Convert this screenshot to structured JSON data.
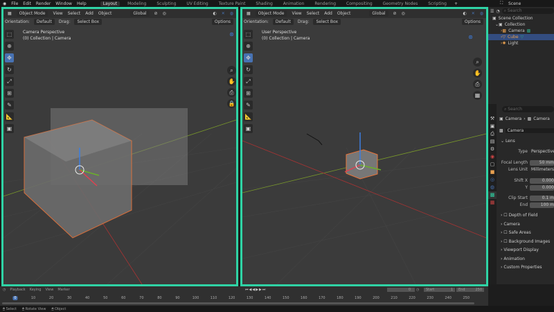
{
  "menu": [
    "File",
    "Edit",
    "Render",
    "Window",
    "Help"
  ],
  "workspaces": [
    "Layout",
    "Modeling",
    "Sculpting",
    "UV Editing",
    "Texture Paint",
    "Shading",
    "Animation",
    "Rendering",
    "Compositing",
    "Geometry Nodes",
    "Scripting"
  ],
  "active_workspace": "Layout",
  "scene": "Scene",
  "viewport_header": {
    "mode": "Object Mode",
    "view": "View",
    "select": "Select",
    "add": "Add",
    "object": "Object",
    "transform": "Global",
    "orientation_label": "Orientation:",
    "orientation": "Default",
    "drag_label": "Drag:",
    "drag": "Select Box",
    "options": "Options"
  },
  "left_viewport": {
    "title": "Camera Perspective",
    "collection": "(0) Collection | Camera"
  },
  "right_viewport": {
    "title": "User Perspective",
    "collection": "(0) Collection | Camera"
  },
  "outliner": {
    "search_placeholder": "Search",
    "items": [
      {
        "label": "Scene Collection"
      },
      {
        "label": "Collection"
      },
      {
        "label": "Camera"
      },
      {
        "label": "Cube"
      },
      {
        "label": "Light"
      }
    ]
  },
  "properties": {
    "search_placeholder": "Search",
    "breadcrumb": [
      "Camera",
      "Camera"
    ],
    "data_name": "Camera",
    "lens_section": "Lens",
    "fields": [
      {
        "label": "Type",
        "value": "Perspective"
      },
      {
        "label": "Focal Length",
        "value": "50 mm"
      },
      {
        "label": "Lens Unit",
        "value": "Millimeters"
      },
      {
        "label": "Shift X",
        "value": "0.000"
      },
      {
        "label": "Y",
        "value": "0.000"
      },
      {
        "label": "Clip Start",
        "value": "0.1 m"
      },
      {
        "label": "End",
        "value": "100 m"
      }
    ],
    "sections": [
      "Depth of Field",
      "Camera",
      "Safe Areas",
      "Background Images",
      "Viewport Display",
      "Animation",
      "Custom Properties"
    ]
  },
  "timeline": {
    "menus": [
      "Playback",
      "Keying",
      "View",
      "Marker"
    ],
    "current_frame": "0",
    "start_label": "Start",
    "start": "1",
    "end_label": "End",
    "end": "250",
    "ticks": [
      "0",
      "10",
      "20",
      "30",
      "40",
      "50",
      "60",
      "70",
      "80",
      "90",
      "100",
      "110",
      "120",
      "130",
      "140",
      "150",
      "160",
      "170",
      "180",
      "190",
      "200",
      "210",
      "220",
      "230",
      "240",
      "250"
    ]
  },
  "status": [
    "Select",
    "Rotate View",
    "Object"
  ],
  "colors": {
    "accent": "#2fd3a5",
    "active_tool": "#4772b3",
    "selection": "#e8743a"
  }
}
